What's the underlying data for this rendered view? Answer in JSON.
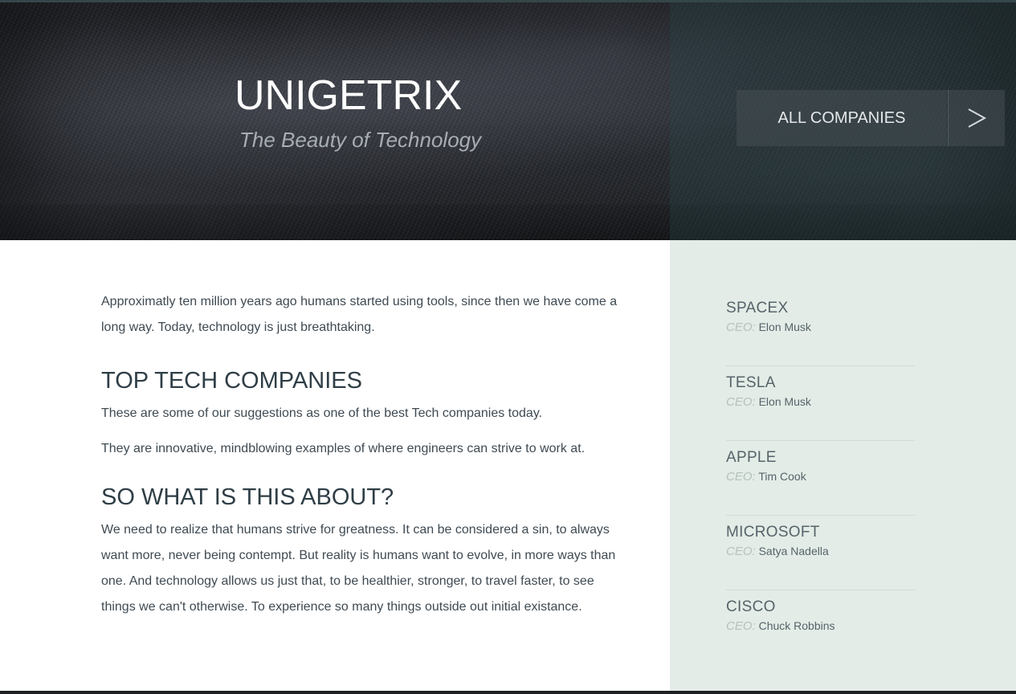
{
  "header": {
    "title": "UNIGETRIX",
    "subtitle": "The Beauty of Technology",
    "all_companies_label": "ALL COMPANIES",
    "arrow_glyph": ">"
  },
  "main": {
    "intro": "Approximatly ten million years ago humans started using tools, since then we have come a long way. Today, technology is just breathtaking.",
    "sections": [
      {
        "heading": "TOP TECH COMPANIES",
        "paragraphs": [
          "These are some of our suggestions as one of the best Tech companies today.",
          "They are innovative, mindblowing examples of where engineers can strive to work at."
        ]
      },
      {
        "heading": "SO WHAT IS THIS ABOUT?",
        "paragraphs": [
          "We need to realize that humans strive for greatness. It can be considered a sin, to always want more, never being contempt. But reality is humans want to evolve, in more ways than one. And technology allows us just that, to be healthier, stronger, to travel faster, to see things we can't otherwise. To experience so many things outside out initial existance."
        ]
      }
    ]
  },
  "sidebar": {
    "ceo_label": "CEO:",
    "companies": [
      {
        "name": "SPACEX",
        "ceo": "Elon Musk"
      },
      {
        "name": "TESLA",
        "ceo": "Elon Musk"
      },
      {
        "name": "APPLE",
        "ceo": "Tim Cook"
      },
      {
        "name": "MICROSOFT",
        "ceo": "Satya Nadella"
      },
      {
        "name": "CISCO",
        "ceo": "Chuck Robbins"
      }
    ]
  },
  "colors": {
    "sidebar_bg": "#e3ece6",
    "text": "#3f4a52",
    "heading": "#2f3e46"
  }
}
